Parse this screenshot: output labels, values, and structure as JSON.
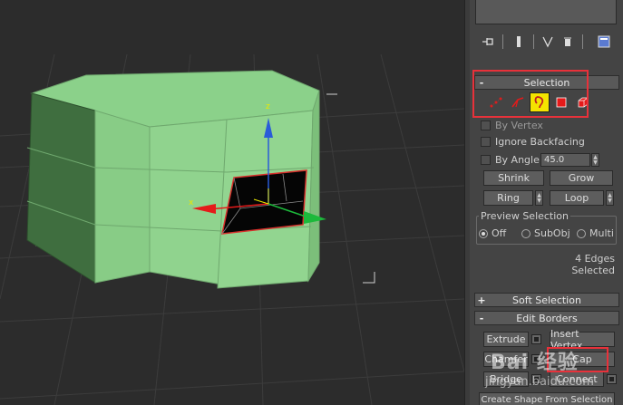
{
  "viewport": {
    "background": "#2c2c2c",
    "object_color": "#90d38e",
    "object_dark_color": "#3f6e3f",
    "selected_edge_color": "#d7302c",
    "gizmo": {
      "x_color": "#e51a1a",
      "y_color": "#2a5bd8",
      "z_color": "#1cb93b"
    }
  },
  "stack_toolbar": {
    "icons": [
      "pin-stack-icon",
      "show-end-result-icon",
      "make-unique-icon",
      "remove-modifier-icon",
      "configure-modifier-sets-icon"
    ]
  },
  "selection": {
    "title": "Selection",
    "sign": "-",
    "levels": [
      {
        "name": "vertex",
        "icon": "vertex-icon",
        "active": false
      },
      {
        "name": "edge",
        "icon": "edge-icon",
        "active": false
      },
      {
        "name": "border",
        "icon": "border-icon",
        "active": true
      },
      {
        "name": "polygon",
        "icon": "polygon-icon",
        "active": false
      },
      {
        "name": "element",
        "icon": "element-icon",
        "active": false
      }
    ],
    "by_vertex": "By Vertex",
    "ignore_backfacing": "Ignore Backfacing",
    "by_angle": "By Angle:",
    "angle_value": "45.0",
    "shrink": "Shrink",
    "grow": "Grow",
    "ring": "Ring",
    "loop": "Loop",
    "preview_title": "Preview Selection",
    "preview_off": "Off",
    "preview_subobj": "SubObj",
    "preview_multi": "Multi",
    "status": "4 Edges Selected"
  },
  "soft_selection": {
    "title": "Soft Selection",
    "sign": "+"
  },
  "edit_borders": {
    "title": "Edit Borders",
    "sign": "-",
    "extrude": "Extrude",
    "insert_vertex": "Insert Vertex",
    "chamfer": "Chamfer",
    "cap": "Cap",
    "bridge": "Bridge",
    "connect": "Connect",
    "create_shape": "Create Shape From Selection"
  },
  "accent_red": "#e8313a",
  "active_yellow": "#f4e400",
  "watermark": {
    "big": "Bai 经验",
    "small": "jingyan.baidu.com"
  }
}
